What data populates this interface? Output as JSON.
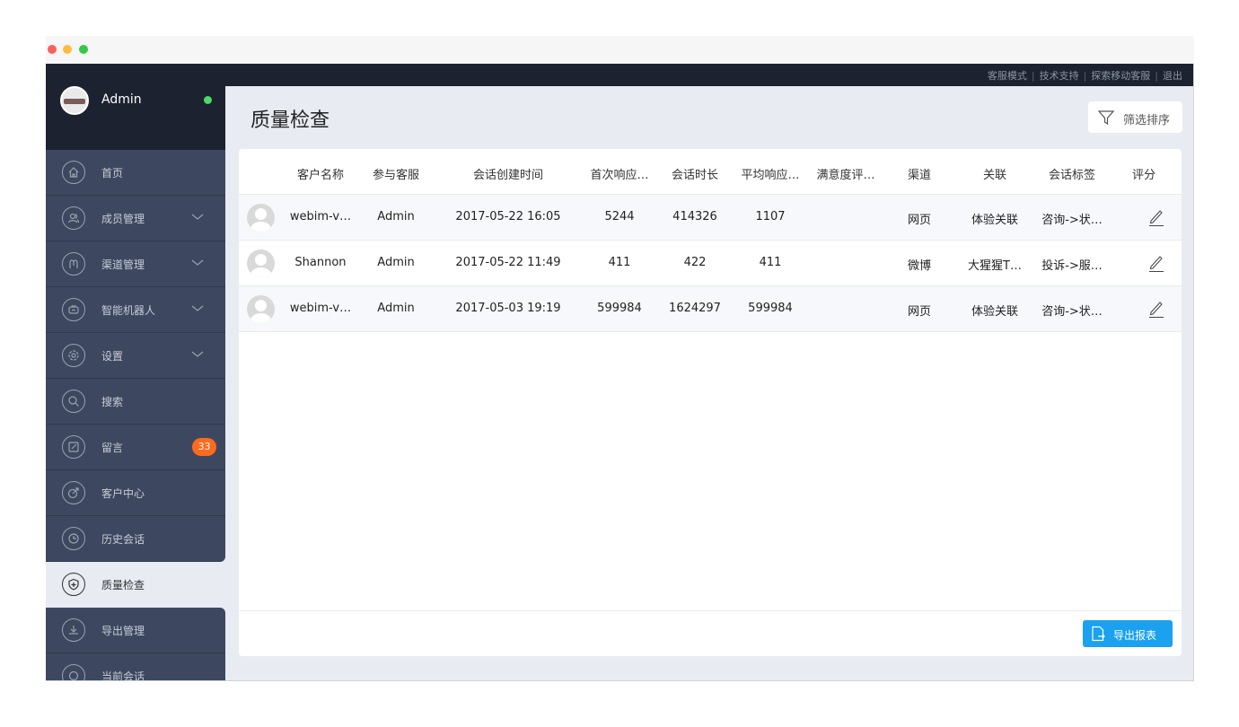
{
  "window": {
    "controls": [
      "close",
      "minimize",
      "maximize"
    ]
  },
  "topbar": {
    "links": [
      "客服模式",
      "技术支持",
      "探索移动客服",
      "退出"
    ],
    "separator": "|"
  },
  "profile": {
    "name": "Admin",
    "status_color": "#4cd964"
  },
  "sidebar": {
    "items": [
      {
        "label": "首页",
        "icon": "home-icon",
        "expandable": false
      },
      {
        "label": "成员管理",
        "icon": "members-icon",
        "expandable": true
      },
      {
        "label": "渠道管理",
        "icon": "channel-icon",
        "expandable": true
      },
      {
        "label": "智能机器人",
        "icon": "robot-icon",
        "expandable": true
      },
      {
        "label": "设置",
        "icon": "settings-icon",
        "expandable": true
      },
      {
        "label": "搜索",
        "icon": "search-icon",
        "expandable": false
      },
      {
        "label": "留言",
        "icon": "message-icon",
        "expandable": false,
        "badge": "33"
      },
      {
        "label": "客户中心",
        "icon": "customer-icon",
        "expandable": false
      },
      {
        "label": "历史会话",
        "icon": "history-icon",
        "expandable": false
      },
      {
        "label": "质量检查",
        "icon": "quality-icon",
        "expandable": false,
        "active": true
      },
      {
        "label": "导出管理",
        "icon": "export-icon",
        "expandable": false
      },
      {
        "label": "当前会话",
        "icon": "chat-icon",
        "expandable": false
      }
    ]
  },
  "main": {
    "title": "质量检查",
    "filter_label": "筛选排序",
    "export_label": "导出报表"
  },
  "table": {
    "headers": [
      "客户名称",
      "参与客服",
      "会话创建时间",
      "首次响应…",
      "会话时长",
      "平均响应…",
      "满意度评…",
      "渠道",
      "关联",
      "会话标签",
      "评分"
    ],
    "rows": [
      [
        "webim-v…",
        "Admin",
        "2017-05-22 16:05",
        "5244",
        "414326",
        "1107",
        "",
        "网页",
        "体验关联",
        "咨询->状…"
      ],
      [
        "Shannon",
        "Admin",
        "2017-05-22 11:49",
        "411",
        "422",
        "411",
        "",
        "微博",
        "大猩猩T…",
        "投诉->服…"
      ],
      [
        "webim-v…",
        "Admin",
        "2017-05-03 19:19",
        "599984",
        "1624297",
        "599984",
        "",
        "网页",
        "体验关联",
        "咨询->状…"
      ]
    ]
  },
  "colors": {
    "sidebar_bg": "#3d4860",
    "topbar_bg": "#1c2230",
    "content_bg": "#e8ebf2",
    "accent": "#1aa1f0",
    "badge": "#ff6a1c"
  }
}
